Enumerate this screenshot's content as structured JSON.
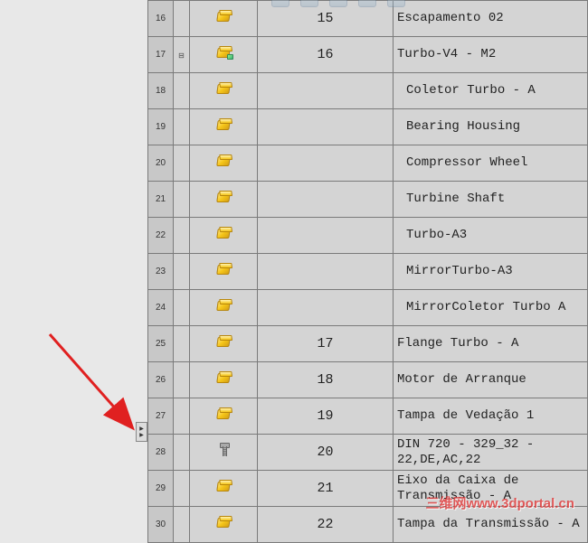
{
  "watermark": "三维网www.3dportal.cn",
  "flyout_label": "▶\n▶",
  "rows": [
    {
      "num": "16",
      "expand": "",
      "icon": "part",
      "item": "15",
      "name": "Escapamento 02",
      "indent": false
    },
    {
      "num": "17",
      "expand": "⊟",
      "icon": "assembly",
      "item": "16",
      "name": "Turbo-V4 - M2",
      "indent": false
    },
    {
      "num": "18",
      "expand": "",
      "icon": "part",
      "item": "",
      "name": "Coletor Turbo - A",
      "indent": true
    },
    {
      "num": "19",
      "expand": "",
      "icon": "part",
      "item": "",
      "name": "Bearing Housing",
      "indent": true
    },
    {
      "num": "20",
      "expand": "",
      "icon": "part",
      "item": "",
      "name": "Compressor Wheel",
      "indent": true
    },
    {
      "num": "21",
      "expand": "",
      "icon": "part",
      "item": "",
      "name": "Turbine Shaft",
      "indent": true
    },
    {
      "num": "22",
      "expand": "",
      "icon": "part",
      "item": "",
      "name": "Turbo-A3",
      "indent": true
    },
    {
      "num": "23",
      "expand": "",
      "icon": "part",
      "item": "",
      "name": "MirrorTurbo-A3",
      "indent": true
    },
    {
      "num": "24",
      "expand": "",
      "icon": "part",
      "item": "",
      "name": "MirrorColetor Turbo A",
      "indent": true
    },
    {
      "num": "25",
      "expand": "",
      "icon": "part",
      "item": "17",
      "name": "Flange Turbo - A",
      "indent": false
    },
    {
      "num": "26",
      "expand": "",
      "icon": "part",
      "item": "18",
      "name": "Motor de Arranque",
      "indent": false
    },
    {
      "num": "27",
      "expand": "",
      "icon": "part",
      "item": "19",
      "name": "Tampa de Vedação 1",
      "indent": false
    },
    {
      "num": "28",
      "expand": "",
      "icon": "bolt",
      "item": "20",
      "name": "DIN 720 - 329_32 - 22,DE,AC,22",
      "indent": false
    },
    {
      "num": "29",
      "expand": "",
      "icon": "part",
      "item": "21",
      "name": "Eixo da Caixa de Transmissão - A",
      "indent": false
    },
    {
      "num": "30",
      "expand": "",
      "icon": "part",
      "item": "22",
      "name": "Tampa da Transmissão - A",
      "indent": false
    }
  ]
}
